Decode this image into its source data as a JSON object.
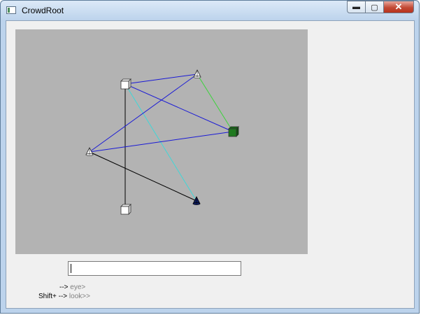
{
  "window": {
    "title": "CrowdRoot",
    "minimize": "▬",
    "maximize": "▢",
    "close": "✕"
  },
  "scene": {
    "nodes": [
      {
        "id": "box-a",
        "shape": "cube",
        "color": "#ffffff"
      },
      {
        "id": "cone-a",
        "shape": "cone",
        "color": "#ffffff"
      },
      {
        "id": "box-green",
        "shape": "cube",
        "color": "#1f7a1f"
      },
      {
        "id": "cone-b",
        "shape": "cone",
        "color": "#ffffff"
      },
      {
        "id": "box-b",
        "shape": "cube",
        "color": "#ffffff"
      },
      {
        "id": "cone-navy",
        "shape": "cone",
        "color": "#0c1a5a"
      }
    ],
    "edges": [
      {
        "from": "box-a",
        "to": "cone-a",
        "color": "#1a1ad6"
      },
      {
        "from": "box-a",
        "to": "box-green",
        "color": "#1a1ad6"
      },
      {
        "from": "box-a",
        "to": "cone-navy",
        "color": "#3fd7d7"
      },
      {
        "from": "box-a",
        "to": "box-b",
        "color": "#000000"
      },
      {
        "from": "cone-a",
        "to": "cone-b",
        "color": "#1a1ad6"
      },
      {
        "from": "cone-a",
        "to": "box-green",
        "color": "#3bd43b"
      },
      {
        "from": "cone-b",
        "to": "box-green",
        "color": "#1a1ad6"
      },
      {
        "from": "cone-b",
        "to": "cone-navy",
        "color": "#000000"
      }
    ]
  },
  "input": {
    "value": ""
  },
  "hints": {
    "line1_key": "-->",
    "line1_action": "eye>",
    "line2_key": "Shift+ -->",
    "line2_action": "look>>"
  }
}
